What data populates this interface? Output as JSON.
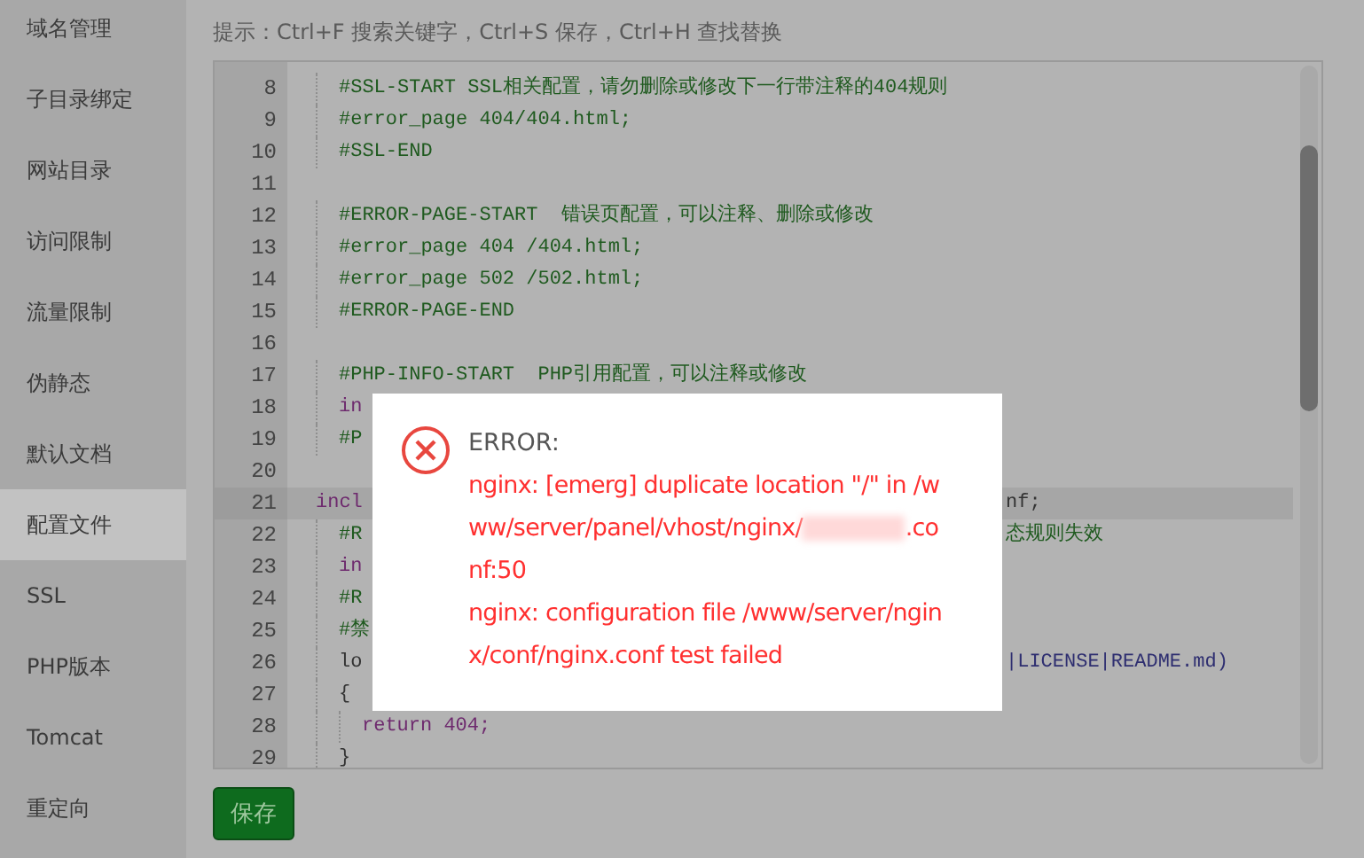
{
  "sidebar": {
    "items": [
      {
        "label": "域名管理",
        "selected": false
      },
      {
        "label": "子目录绑定",
        "selected": false
      },
      {
        "label": "网站目录",
        "selected": false
      },
      {
        "label": "访问限制",
        "selected": false
      },
      {
        "label": "流量限制",
        "selected": false
      },
      {
        "label": "伪静态",
        "selected": false
      },
      {
        "label": "默认文档",
        "selected": false
      },
      {
        "label": "配置文件",
        "selected": true
      },
      {
        "label": "SSL",
        "selected": false
      },
      {
        "label": "PHP版本",
        "selected": false
      },
      {
        "label": "Tomcat",
        "selected": false
      },
      {
        "label": "重定向",
        "selected": false
      }
    ]
  },
  "hint": "提示：Ctrl+F 搜索关键字，Ctrl+S 保存，Ctrl+H 查找替换",
  "editor": {
    "lines": [
      {
        "number": "8",
        "kind": "comment",
        "text": "  #SSL-START SSL相关配置，请勿删除或修改下一行带注释的404规则",
        "active": false
      },
      {
        "number": "9",
        "kind": "comment",
        "text": "  #error_page 404/404.html;",
        "active": false
      },
      {
        "number": "10",
        "kind": "comment",
        "text": "  #SSL-END",
        "active": false
      },
      {
        "number": "11",
        "kind": "blank",
        "active": false
      },
      {
        "number": "12",
        "kind": "comment",
        "text": "  #ERROR-PAGE-START  错误页配置，可以注释、删除或修改",
        "active": false
      },
      {
        "number": "13",
        "kind": "comment",
        "text": "  #error_page 404 /404.html;",
        "active": false
      },
      {
        "number": "14",
        "kind": "comment",
        "text": "  #error_page 502 /502.html;",
        "active": false
      },
      {
        "number": "15",
        "kind": "comment",
        "text": "  #ERROR-PAGE-END",
        "active": false
      },
      {
        "number": "16",
        "kind": "blank",
        "active": false
      },
      {
        "number": "17",
        "kind": "comment",
        "text": "  #PHP-INFO-START  PHP引用配置，可以注释或修改",
        "active": false
      },
      {
        "number": "18",
        "kind": "keyword",
        "text": "  in",
        "active": false
      },
      {
        "number": "19",
        "kind": "comment",
        "text": "  #P",
        "active": false
      },
      {
        "number": "20",
        "kind": "blank",
        "active": false
      },
      {
        "number": "21",
        "kind": "keyword",
        "text": "incl",
        "tail": {
          "text": "nf;",
          "kind": "plain"
        },
        "active": true
      },
      {
        "number": "22",
        "kind": "comment",
        "text": "  #R",
        "tail": {
          "text": "态规则失效",
          "kind": "comment"
        },
        "active": false
      },
      {
        "number": "23",
        "kind": "keyword",
        "text": "  in",
        "active": false
      },
      {
        "number": "24",
        "kind": "comment",
        "text": "  #R",
        "active": false
      },
      {
        "number": "25",
        "kind": "comment",
        "text": "  #禁",
        "active": false
      },
      {
        "number": "26",
        "kind": "plain",
        "text": "  lo",
        "tail": {
          "text": "|LICENSE|README.md)",
          "kind": "string"
        },
        "active": false
      },
      {
        "number": "27",
        "kind": "plain",
        "text": "  {",
        "active": false
      },
      {
        "number": "28",
        "kind": "keyword",
        "text": "    return 404;",
        "active": false
      },
      {
        "number": "29",
        "kind": "plain",
        "text": "  }",
        "active": false
      }
    ]
  },
  "save_button": "保存",
  "dialog": {
    "title": "ERROR:",
    "lines": [
      {
        "text": "nginx: [emerg] duplicate location \"/\" in /w"
      },
      {
        "text": "ww/server/panel/vhost/nginx/",
        "after_redaction": ".co"
      },
      {
        "text": "nf:50"
      },
      {
        "text": "nginx: configuration file /www/server/ngin"
      },
      {
        "text": "x/conf/nginx.conf test failed"
      }
    ]
  }
}
